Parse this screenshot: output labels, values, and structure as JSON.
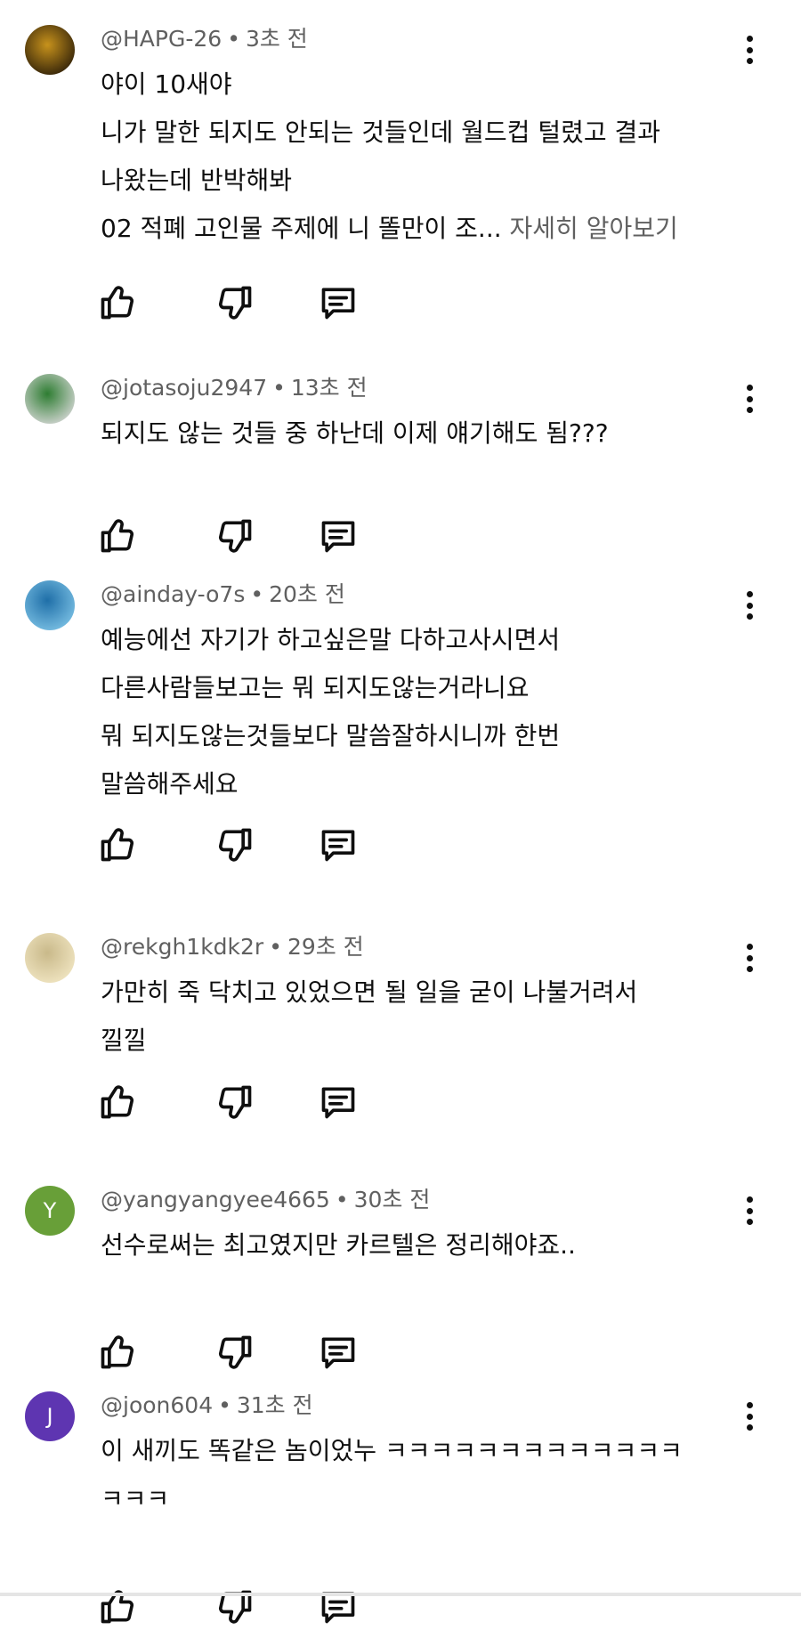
{
  "comments": [
    {
      "author": "@HAPG-26",
      "time": "3초 전",
      "lines": [
        "야이 10새야",
        "니가 말한 되지도 안되는 것들인데 월드컵 털렸고 결과",
        "나왔는데 반박해봐",
        "02 적폐 고인물 주제에 니 똘만이 조..."
      ],
      "more": "자세히 알아보기",
      "avatar": {
        "type": "photo",
        "colors": [
          "#2a1c08",
          "#c7921c"
        ]
      }
    },
    {
      "author": "@jotasoju2947",
      "time": "13초 전",
      "lines": [
        "되지도 않는 것들 중 하난데 이제 얘기해도 됨???"
      ],
      "more": "",
      "avatar": {
        "type": "photo",
        "colors": [
          "#d9d9d9",
          "#2e7d32"
        ]
      }
    },
    {
      "author": "@ainday-o7s",
      "time": "20초 전",
      "lines": [
        "예능에선 자기가 하고싶은말 다하고사시면서",
        "다른사람들보고는 뭐 되지도않는거라니요",
        "뭐 되지도않는것들보다 말씀잘하시니까 한번",
        "말씀해주세요"
      ],
      "more": "",
      "avatar": {
        "type": "photo",
        "colors": [
          "#7ec3e6",
          "#1f6fa8"
        ]
      }
    },
    {
      "author": "@rekgh1kdk2r",
      "time": "29초 전",
      "lines": [
        "가만히 죽 닥치고 있었으면 될 일을 굳이 나불거려서",
        "낄낄"
      ],
      "more": "",
      "avatar": {
        "type": "photo",
        "colors": [
          "#f2e7c4",
          "#c9b98a"
        ]
      }
    },
    {
      "author": "@yangyangyee4665",
      "time": "30초 전",
      "lines": [
        "선수로써는 최고였지만 카르텔은 정리해야죠.."
      ],
      "more": "",
      "avatar": {
        "type": "letter",
        "letter": "Y",
        "colors": [
          "#689f38"
        ]
      }
    },
    {
      "author": "@joon604",
      "time": "31초 전",
      "lines": [
        "이 새끼도 똑같은 놈이었누 ㅋㅋㅋㅋㅋㅋㅋㅋㅋㅋㅋㅋㅋ",
        "ㅋㅋㅋ"
      ],
      "more": "",
      "avatar": {
        "type": "letter",
        "letter": "J",
        "colors": [
          "#5e35b1"
        ]
      }
    }
  ],
  "icons": {
    "like": "thumbs-up-icon",
    "dislike": "thumbs-down-icon",
    "reply": "reply-comment-icon",
    "menu": "more-vert-icon"
  }
}
